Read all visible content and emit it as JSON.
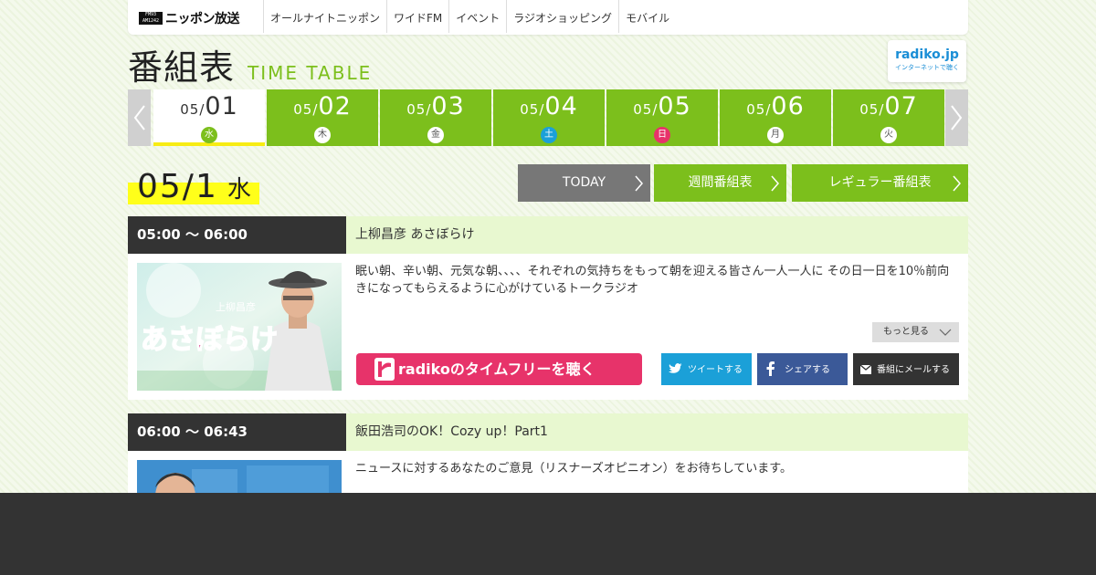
{
  "header": {
    "logo": {
      "badge": "FM93 AM1242",
      "text": "ニッポン放送"
    },
    "nav": [
      "オールナイトニッポン",
      "ワイドFM",
      "イベント",
      "ラジオショッピング",
      "モバイル"
    ]
  },
  "title": {
    "ja": "番組表",
    "en": "TIME TABLE"
  },
  "radiko_badge": {
    "line1": "radiko.jp",
    "line2": "インターネットで聴く"
  },
  "days": [
    {
      "md": "05/",
      "dd": "01",
      "wk": "水",
      "wk_color": "#7cbf1c",
      "active": true
    },
    {
      "md": "05/",
      "dd": "02",
      "wk": "木",
      "wk_color": "#555555",
      "active": false
    },
    {
      "md": "05/",
      "dd": "03",
      "wk": "金",
      "wk_color": "#555555",
      "active": false
    },
    {
      "md": "05/",
      "dd": "04",
      "wk": "土",
      "wk_color": "#1ba0d8",
      "active": false
    },
    {
      "md": "05/",
      "dd": "05",
      "wk": "日",
      "wk_color": "#e7336a",
      "active": false
    },
    {
      "md": "05/",
      "dd": "06",
      "wk": "月",
      "wk_color": "#555555",
      "active": false
    },
    {
      "md": "05/",
      "dd": "07",
      "wk": "火",
      "wk_color": "#555555",
      "active": false
    }
  ],
  "current": {
    "date": "05/1",
    "weekday": "水"
  },
  "buttons": {
    "today": "TODAY",
    "week": "週間番組表",
    "regular": "レギュラー番組表"
  },
  "programs": [
    {
      "time": "05:00 ～ 06:00",
      "title": "上柳昌彦 あさぼらけ",
      "desc": "眠い朝、辛い朝、元気な朝、、、、それぞれの気持ちをもって朝を迎える皆さん一人一人に その日一日を10％前向きになってもらえるように心がけているトークラジオ",
      "thumb_text": "あさぼらけ",
      "thumb_sub": "上柳昌彦",
      "more": "もっと見る",
      "radiko": "radikoのタイムフリーを聴く",
      "tweet": "ツイートする",
      "share": "シェアする",
      "mail": "番組にメールする"
    },
    {
      "time": "06:00 ～ 06:43",
      "title": "飯田浩司のOK！Cozy up！Part1",
      "desc": "ニュースに対するあなたのご意見（リスナーズオピニオン）をお待ちしています。"
    }
  ],
  "colors": {
    "accent": "#7cbf1c",
    "highlight": "#ffff1a",
    "radiko": "#e7336a",
    "twitter": "#1ba0d8",
    "facebook": "#3b5998"
  }
}
